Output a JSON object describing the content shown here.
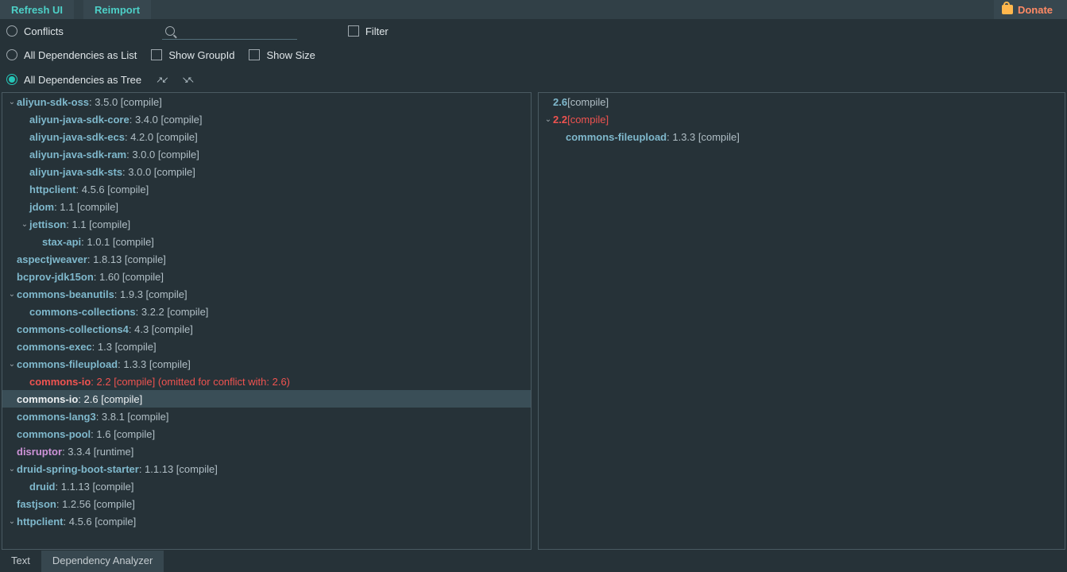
{
  "toolbar": {
    "refresh": "Refresh UI",
    "reimport": "Reimport",
    "donate": "Donate"
  },
  "filters": {
    "conflicts": "Conflicts",
    "filter": "Filter",
    "all_list": "All Dependencies as List",
    "show_groupid": "Show GroupId",
    "show_size": "Show Size",
    "all_tree": "All Dependencies as Tree",
    "search_placeholder": ""
  },
  "left_tree": [
    {
      "indent": 0,
      "caret": "v",
      "name": "aliyun-sdk-oss",
      "meta": " : 3.5.0 [compile]"
    },
    {
      "indent": 1,
      "caret": "",
      "name": "aliyun-java-sdk-core",
      "meta": " : 3.4.0 [compile]"
    },
    {
      "indent": 1,
      "caret": "",
      "name": "aliyun-java-sdk-ecs",
      "meta": " : 4.2.0 [compile]"
    },
    {
      "indent": 1,
      "caret": "",
      "name": "aliyun-java-sdk-ram",
      "meta": " : 3.0.0 [compile]"
    },
    {
      "indent": 1,
      "caret": "",
      "name": "aliyun-java-sdk-sts",
      "meta": " : 3.0.0 [compile]"
    },
    {
      "indent": 1,
      "caret": "",
      "name": "httpclient",
      "meta": " : 4.5.6 [compile]"
    },
    {
      "indent": 1,
      "caret": "",
      "name": "jdom",
      "meta": " : 1.1 [compile]"
    },
    {
      "indent": 1,
      "caret": "v",
      "name": "jettison",
      "meta": " : 1.1 [compile]"
    },
    {
      "indent": 2,
      "caret": "",
      "name": "stax-api",
      "meta": " : 1.0.1 [compile]"
    },
    {
      "indent": 0,
      "caret": "",
      "name": "aspectjweaver",
      "meta": " : 1.8.13 [compile]"
    },
    {
      "indent": 0,
      "caret": "",
      "name": "bcprov-jdk15on",
      "meta": " : 1.60 [compile]"
    },
    {
      "indent": 0,
      "caret": "v",
      "name": "commons-beanutils",
      "meta": " : 1.9.3 [compile]"
    },
    {
      "indent": 1,
      "caret": "",
      "name": "commons-collections",
      "meta": " : 3.2.2 [compile]"
    },
    {
      "indent": 0,
      "caret": "",
      "name": "commons-collections4",
      "meta": " : 4.3 [compile]"
    },
    {
      "indent": 0,
      "caret": "",
      "name": "commons-exec",
      "meta": " : 1.3 [compile]"
    },
    {
      "indent": 0,
      "caret": "v",
      "name": "commons-fileupload",
      "meta": " : 1.3.3 [compile]"
    },
    {
      "indent": 1,
      "caret": "",
      "name": "commons-io",
      "meta": " : 2.2 [compile] (omitted for conflict with: 2.6)",
      "style": "conflict"
    },
    {
      "indent": 0,
      "caret": "",
      "name": "commons-io",
      "meta": " : 2.6 [compile]",
      "selected": true
    },
    {
      "indent": 0,
      "caret": "",
      "name": "commons-lang3",
      "meta": " : 3.8.1 [compile]"
    },
    {
      "indent": 0,
      "caret": "",
      "name": "commons-pool",
      "meta": " : 1.6 [compile]"
    },
    {
      "indent": 0,
      "caret": "",
      "name": "disruptor",
      "meta": " : 3.3.4 [runtime]",
      "style": "runtime"
    },
    {
      "indent": 0,
      "caret": "v",
      "name": "druid-spring-boot-starter",
      "meta": " : 1.1.13 [compile]"
    },
    {
      "indent": 1,
      "caret": "",
      "name": "druid",
      "meta": " : 1.1.13 [compile]"
    },
    {
      "indent": 0,
      "caret": "",
      "name": "fastjson",
      "meta": " : 1.2.56 [compile]"
    },
    {
      "indent": 0,
      "caret": "v",
      "name": "httpclient",
      "meta": " : 4.5.6 [compile]"
    }
  ],
  "right_tree": [
    {
      "indent": 0,
      "caret": "",
      "name": "2.6",
      "meta": " [compile]"
    },
    {
      "indent": 0,
      "caret": "v",
      "name": "2.2",
      "meta": " [compile]",
      "style": "conflict"
    },
    {
      "indent": 1,
      "caret": "",
      "name": "commons-fileupload",
      "meta": " : 1.3.3 [compile]"
    }
  ],
  "tabs": {
    "text": "Text",
    "dep": "Dependency Analyzer"
  }
}
